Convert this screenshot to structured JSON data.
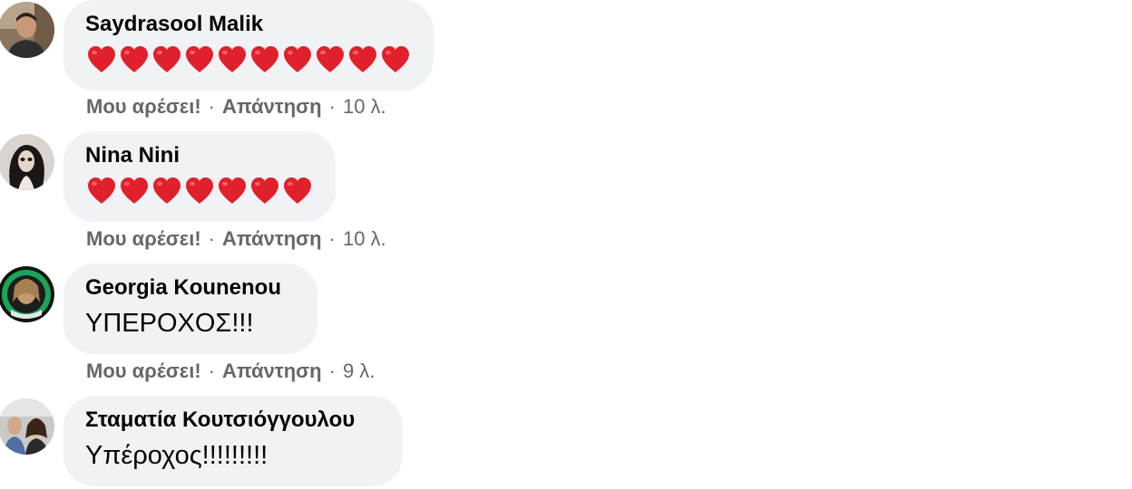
{
  "comments": [
    {
      "author": "Saydrasool Malik",
      "content_type": "hearts",
      "heart_count": 10,
      "heart_emoji": "❤️",
      "like_label": "Μου αρέσει!",
      "reply_label": "Απάντηση",
      "time": "10 λ."
    },
    {
      "author": "Nina Nini",
      "content_type": "hearts",
      "heart_count": 7,
      "heart_emoji": "❤️",
      "like_label": "Μου αρέσει!",
      "reply_label": "Απάντηση",
      "time": "10 λ."
    },
    {
      "author": "Georgia Kounenou",
      "content_type": "text",
      "text": "ΥΠΕΡΟΧΟΣ!!!",
      "like_label": "Μου αρέσει!",
      "reply_label": "Απάντηση",
      "time": "9 λ."
    },
    {
      "author": "Σταματία Κουτσιόγγουλου",
      "content_type": "text",
      "text": "Υπέροχος!!!!!!!!!",
      "like_label": "",
      "reply_label": "",
      "time": ""
    }
  ],
  "separator": "·",
  "colors": {
    "bubble": "#f0f2f5",
    "author": "#050505",
    "meta": "#65676b",
    "heart": "#e0202b"
  }
}
